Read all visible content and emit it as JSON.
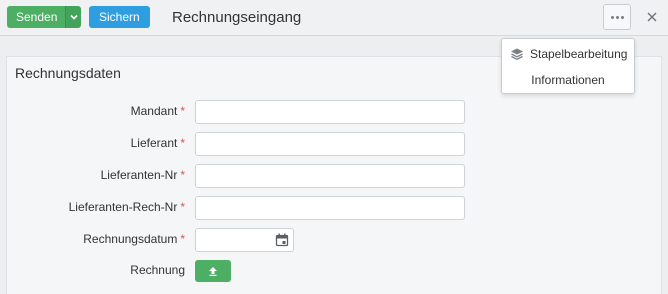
{
  "toolbar": {
    "send_label": "Senden",
    "save_label": "Sichern",
    "title": "Rechnungseingang"
  },
  "menu": {
    "items": [
      {
        "label": "Stapelbearbeitung",
        "icon": "layers-icon"
      },
      {
        "label": "Informationen"
      }
    ]
  },
  "panel": {
    "title": "Rechnungsdaten",
    "fields": [
      {
        "label": "Mandant",
        "required": "*",
        "value": ""
      },
      {
        "label": "Lieferant",
        "required": "*",
        "value": ""
      },
      {
        "label": "Lieferanten-Nr",
        "required": "*",
        "value": ""
      },
      {
        "label": "Lieferanten-Rech-Nr",
        "required": "*",
        "value": ""
      },
      {
        "label": "Rechnungsdatum",
        "required": "*",
        "value": ""
      },
      {
        "label": "Rechnung"
      }
    ]
  },
  "colors": {
    "send": "#4caf63",
    "save": "#2f9ee0",
    "required": "#d9534f",
    "upload": "#4caf63"
  }
}
